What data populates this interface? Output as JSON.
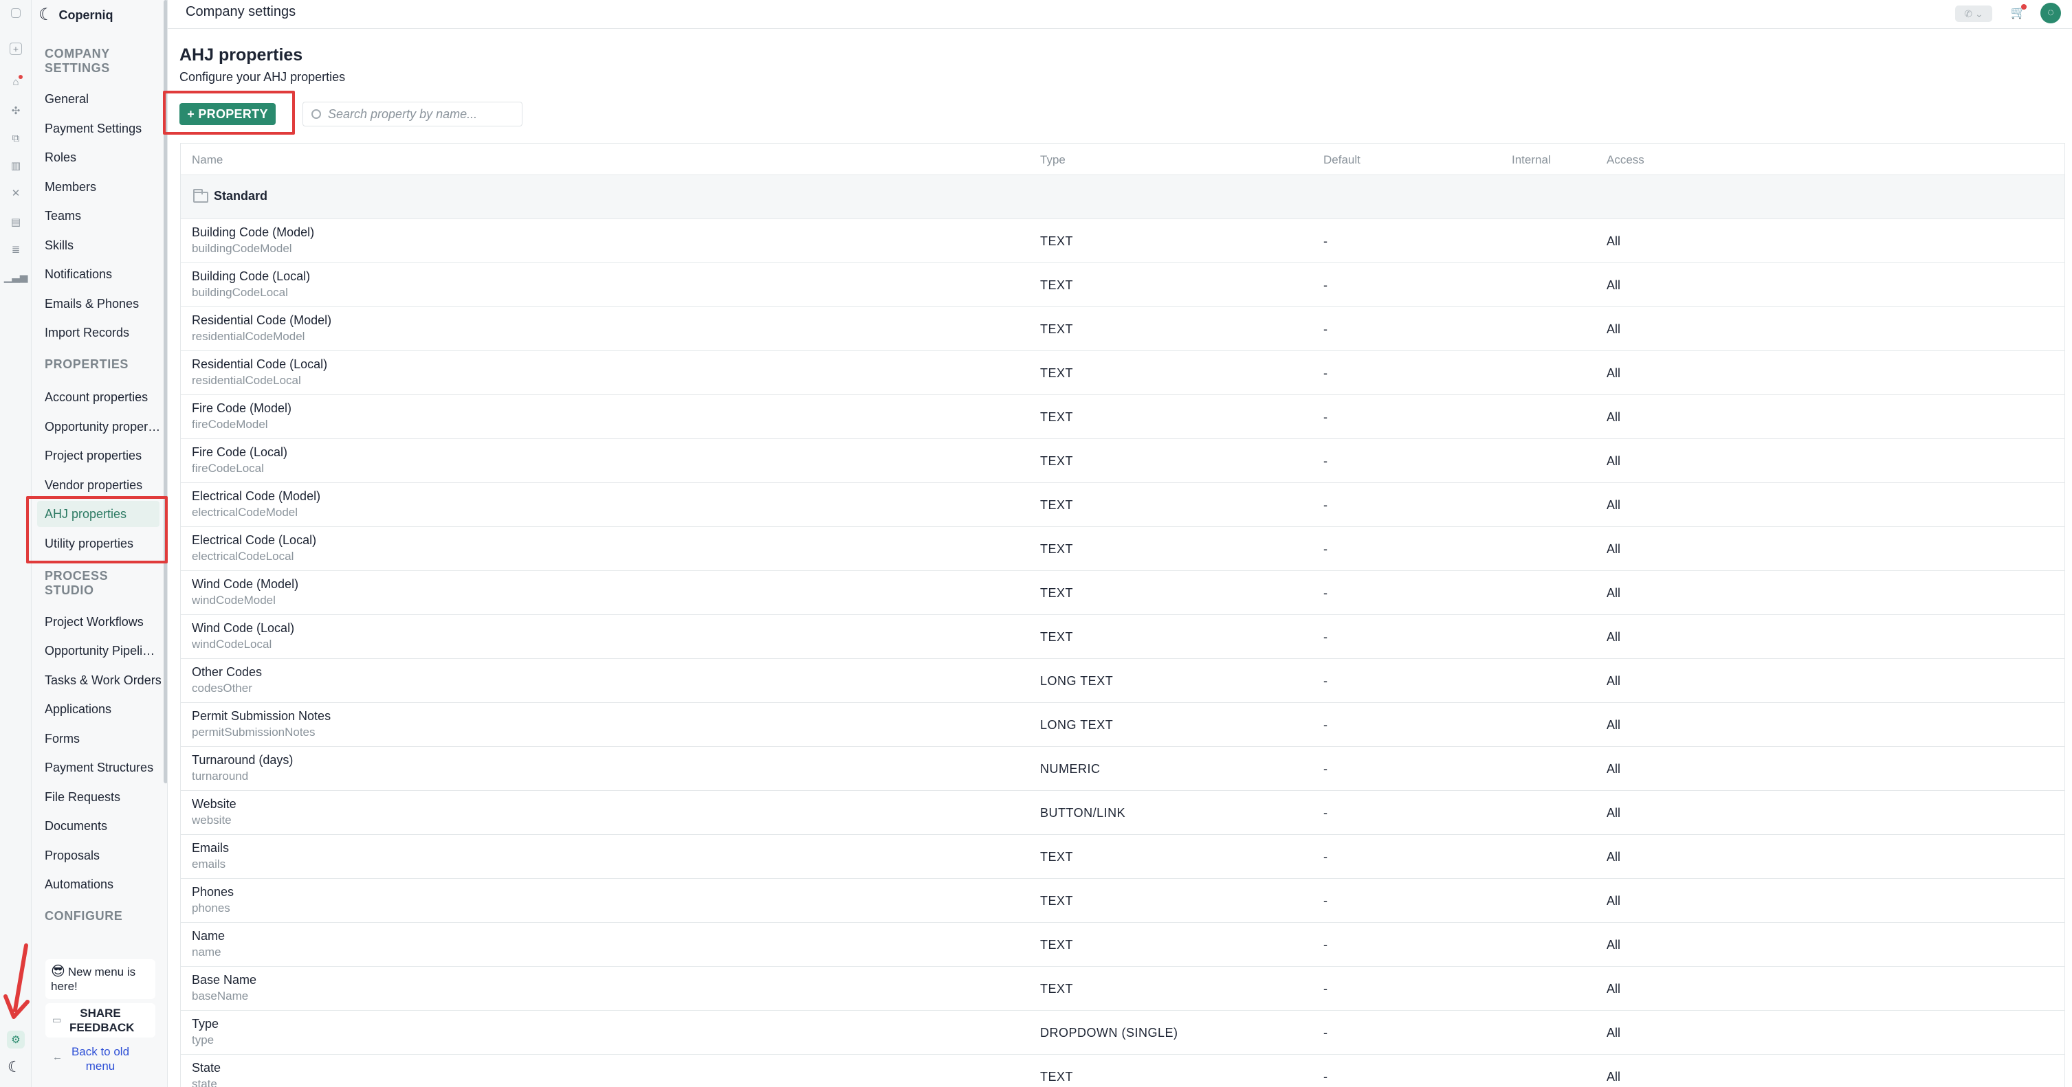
{
  "app": {
    "brand": "Coperniq"
  },
  "topbar": {
    "title": "Company settings"
  },
  "sidebar": {
    "sections": [
      {
        "title": "COMPANY SETTINGS",
        "items": [
          "General",
          "Payment Settings",
          "Roles",
          "Members",
          "Teams",
          "Skills",
          "Notifications",
          "Emails & Phones",
          "Import Records"
        ]
      },
      {
        "title": "PROPERTIES",
        "items": [
          "Account properties",
          "Opportunity properties",
          "Project properties",
          "Vendor properties",
          "AHJ properties",
          "Utility properties"
        ]
      },
      {
        "title": "PROCESS STUDIO",
        "items": [
          "Project Workflows",
          "Opportunity Pipelines",
          "Tasks & Work Orders",
          "Applications",
          "Forms",
          "Payment Structures",
          "File Requests",
          "Documents",
          "Proposals",
          "Automations"
        ]
      },
      {
        "title": "CONFIGURE",
        "items": []
      }
    ],
    "active_item": "AHJ properties",
    "promo": {
      "emoji": "😎",
      "text": "New menu is here!"
    },
    "share_feedback": "SHARE FEEDBACK",
    "back_to_old": "Back to old menu"
  },
  "main": {
    "title": "AHJ properties",
    "subtitle": "Configure your AHJ properties",
    "add_button": "+ PROPERTY",
    "search_placeholder": "Search property by name...",
    "columns": [
      "Name",
      "Type",
      "Default",
      "Internal",
      "Access"
    ],
    "group": "Standard",
    "rows": [
      {
        "name": "Building Code (Model)",
        "key": "buildingCodeModel",
        "type": "TEXT",
        "default": "-",
        "access": "All"
      },
      {
        "name": "Building Code (Local)",
        "key": "buildingCodeLocal",
        "type": "TEXT",
        "default": "-",
        "access": "All"
      },
      {
        "name": "Residential Code (Model)",
        "key": "residentialCodeModel",
        "type": "TEXT",
        "default": "-",
        "access": "All"
      },
      {
        "name": "Residential Code (Local)",
        "key": "residentialCodeLocal",
        "type": "TEXT",
        "default": "-",
        "access": "All"
      },
      {
        "name": "Fire Code (Model)",
        "key": "fireCodeModel",
        "type": "TEXT",
        "default": "-",
        "access": "All"
      },
      {
        "name": "Fire Code (Local)",
        "key": "fireCodeLocal",
        "type": "TEXT",
        "default": "-",
        "access": "All"
      },
      {
        "name": "Electrical Code (Model)",
        "key": "electricalCodeModel",
        "type": "TEXT",
        "default": "-",
        "access": "All"
      },
      {
        "name": "Electrical Code (Local)",
        "key": "electricalCodeLocal",
        "type": "TEXT",
        "default": "-",
        "access": "All"
      },
      {
        "name": "Wind Code (Model)",
        "key": "windCodeModel",
        "type": "TEXT",
        "default": "-",
        "access": "All"
      },
      {
        "name": "Wind Code (Local)",
        "key": "windCodeLocal",
        "type": "TEXT",
        "default": "-",
        "access": "All"
      },
      {
        "name": "Other Codes",
        "key": "codesOther",
        "type": "LONG TEXT",
        "default": "-",
        "access": "All"
      },
      {
        "name": "Permit Submission Notes",
        "key": "permitSubmissionNotes",
        "type": "LONG TEXT",
        "default": "-",
        "access": "All"
      },
      {
        "name": "Turnaround (days)",
        "key": "turnaround",
        "type": "NUMERIC",
        "default": "-",
        "access": "All"
      },
      {
        "name": "Website",
        "key": "website",
        "type": "BUTTON/LINK",
        "default": "-",
        "access": "All"
      },
      {
        "name": "Emails",
        "key": "emails",
        "type": "TEXT",
        "default": "-",
        "access": "All"
      },
      {
        "name": "Phones",
        "key": "phones",
        "type": "TEXT",
        "default": "-",
        "access": "All"
      },
      {
        "name": "Name",
        "key": "name",
        "type": "TEXT",
        "default": "-",
        "access": "All"
      },
      {
        "name": "Base Name",
        "key": "baseName",
        "type": "TEXT",
        "default": "-",
        "access": "All"
      },
      {
        "name": "Type",
        "key": "type",
        "type": "DROPDOWN (SINGLE)",
        "default": "-",
        "access": "All"
      },
      {
        "name": "State",
        "key": "state",
        "type": "TEXT",
        "default": "-",
        "access": "All"
      }
    ]
  },
  "colors": {
    "accent": "#2a8a6e",
    "highlight": "#e03b3b",
    "active_bg": "#e7f1ee"
  }
}
